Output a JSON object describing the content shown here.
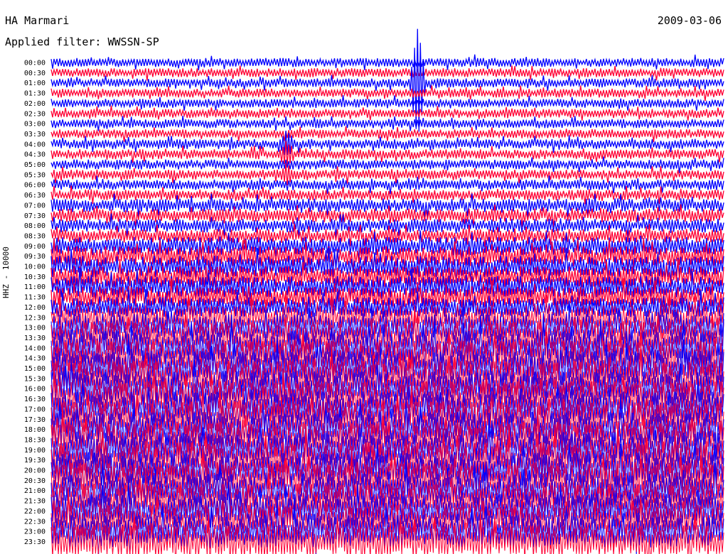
{
  "header": {
    "station": "HA Marmari",
    "filter": "Applied filter: WWSSN-SP",
    "date": "2009-03-06"
  },
  "channel_label": "HHZ - 10000",
  "colors": {
    "trace_a": "#0000ff",
    "trace_b": "#ff0033",
    "background": "#ffffff"
  },
  "chart_data": {
    "type": "line",
    "title": "",
    "ylabel": "HHZ - 10000",
    "xlabel": "",
    "grid": false,
    "legend": "none",
    "row_labels": [
      "00:00",
      "00:30",
      "01:00",
      "01:30",
      "02:00",
      "02:30",
      "03:00",
      "03:30",
      "04:00",
      "04:30",
      "05:00",
      "05:30",
      "06:00",
      "06:30",
      "07:00",
      "07:30",
      "08:00",
      "08:30",
      "09:00",
      "09:30",
      "10:00",
      "10:30",
      "11:00",
      "11:30",
      "12:00",
      "12:30",
      "13:00",
      "13:30",
      "14:00",
      "14:30",
      "15:00",
      "15:30",
      "16:00",
      "16:30",
      "17:00",
      "17:30",
      "18:00",
      "18:30",
      "19:00",
      "19:30",
      "20:00",
      "20:30",
      "21:00",
      "21:30",
      "22:00",
      "22:30",
      "23:00",
      "23:30"
    ],
    "row_colors": "alternating blue / red",
    "row_activity": [
      0.15,
      0.15,
      0.15,
      0.15,
      0.15,
      0.15,
      0.15,
      0.15,
      0.18,
      0.18,
      0.18,
      0.18,
      0.2,
      0.2,
      0.3,
      0.3,
      0.3,
      0.3,
      0.45,
      0.5,
      0.55,
      0.55,
      0.55,
      0.55,
      0.5,
      0.7,
      0.8,
      0.9,
      0.95,
      1.0,
      1.0,
      1.0,
      1.0,
      1.0,
      1.0,
      1.0,
      1.0,
      1.0,
      1.0,
      1.0,
      1.0,
      1.0,
      0.95,
      0.95,
      0.95,
      0.9,
      0.9,
      0.9
    ],
    "events": [
      {
        "row": "01:00",
        "x_fraction": 0.545,
        "amplitude": 12
      },
      {
        "row": "04:00",
        "x_fraction": 0.35,
        "amplitude": 2
      },
      {
        "row": "04:30",
        "x_fraction": 0.35,
        "amplitude": 2
      },
      {
        "row": "05:30",
        "x_fraction": 0.35,
        "amplitude": 1.5
      }
    ]
  }
}
